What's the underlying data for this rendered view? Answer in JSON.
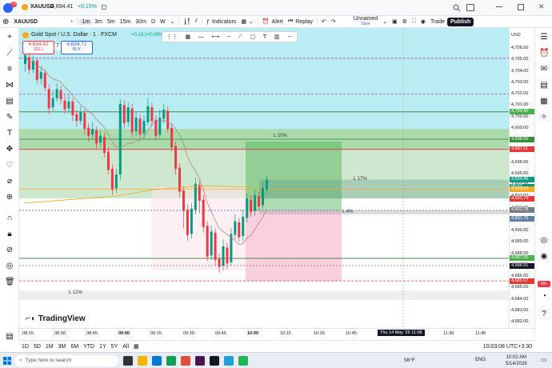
{
  "topbar": {
    "notif_count": "13",
    "symbol": "XAUUSD",
    "price": "4,694.41",
    "change": "+0.15%",
    "change_color": "#089981"
  },
  "toolbar": {
    "symbol_search": "XAUUSD",
    "timeframes": [
      "1m",
      "3m",
      "5m",
      "15m",
      "30m",
      "D",
      "W"
    ],
    "selected_timeframe": "1m",
    "indicators": "Indicators",
    "alert": "Alert",
    "replay": "Replay",
    "layout_name": "Unnamed",
    "layout_status": "Save",
    "trade": "Trade",
    "publish": "Publish"
  },
  "legend": {
    "title": "Gold Spot / U.S. Dollar · 1 · FXCM",
    "change": "+0.13 (+0.00%",
    "sell_price": "4,694.42",
    "sell_label": "SELL",
    "spread": "7",
    "buy_price": "4,694.72",
    "buy_label": "BUY"
  },
  "zones": {
    "upper_label": "L 10%",
    "mid_label": "L 17%",
    "low_label": "L 4%",
    "bottom_label": "L 12%"
  },
  "price_axis": {
    "currency": "USD",
    "ticks": [
      "4,706.00",
      "4,705.00",
      "4,704.00",
      "4,703.00",
      "4,702.00",
      "4,701.00",
      "4,700.00",
      "4,699.00",
      "4,698.00",
      "4,697.00",
      "4,696.00",
      "4,695.00",
      "4,694.00",
      "4,693.00",
      "4,692.00",
      "4,691.00",
      "4,690.00",
      "4,689.00",
      "4,688.00",
      "4,687.00",
      "4,686.00",
      "4,685.00",
      "4,684.00",
      "4,683.00",
      "4,682.00"
    ],
    "tags": [
      {
        "text": "4,700.40",
        "color": "#4caf50"
      },
      {
        "text": "4,698.00",
        "color": "#388e3c"
      },
      {
        "text": "4,697.11",
        "color": "#e53935"
      },
      {
        "text": "4,694.45",
        "color": "#089981"
      },
      {
        "text": "00:52",
        "color": "#089981"
      },
      {
        "text": "4,693.63",
        "color": "#f9a825"
      },
      {
        "text": "4,692.79",
        "color": "#e53935"
      },
      {
        "text": "4,691.78",
        "color": "#787b86"
      },
      {
        "text": "4,691.75",
        "color": "#5b7fa8"
      },
      {
        "text": "4,687.55",
        "color": "#4caf50"
      },
      {
        "text": "4,686.91",
        "color": "#131722"
      },
      {
        "text": "4,685.57",
        "color": "#e53935"
      }
    ]
  },
  "time_axis": {
    "ticks": [
      "08:15",
      "08:30",
      "08:45",
      "09:00",
      "09:15",
      "09:30",
      "09:45",
      "10:00",
      "10:15",
      "10:30",
      "10:45",
      "11:30",
      "11:45"
    ],
    "crosshair_date": "Thu 14 May '26",
    "crosshair_time": "11:08"
  },
  "bottombar": {
    "ranges": [
      "1D",
      "5D",
      "1M",
      "3M",
      "6M",
      "YTD",
      "1Y",
      "5Y",
      "All"
    ],
    "clock": "10:03:08 UTC+3:30"
  },
  "watermark": "TradingView",
  "taskbar": {
    "search_placeholder": "Type here to search",
    "weather": "56°F",
    "lang": "ENG",
    "time": "10:02 AM",
    "date": "5/14/2026"
  },
  "right_badge": "99+"
}
